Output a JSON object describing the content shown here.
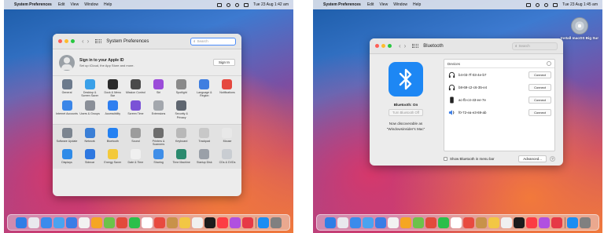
{
  "left": {
    "menubar": {
      "app": "System Preferences",
      "items": [
        "Edit",
        "View",
        "Window",
        "Help"
      ],
      "clock": "Tue 23 Aug  1:42 am"
    },
    "window": {
      "title": "System Preferences",
      "search_placeholder": "Search",
      "apple_id": {
        "title": "Sign in to your Apple ID",
        "subtitle": "Set up iCloud, the App Store and more.",
        "button": "Sign In"
      },
      "rows": [
        [
          {
            "label": "General",
            "color": "#6c7a8c",
            "icon": "general-icon"
          },
          {
            "label": "Desktop & Screen Saver",
            "color": "#3aa0e8",
            "icon": "desktop-icon"
          },
          {
            "label": "Dock & Menu Bar",
            "color": "#2b2b2b",
            "icon": "dock-icon"
          },
          {
            "label": "Mission Control",
            "color": "#4a4a4a",
            "icon": "mission-control-icon"
          },
          {
            "label": "Siri",
            "color": "#9b4cd9",
            "icon": "siri-icon"
          },
          {
            "label": "Spotlight",
            "color": "#8a8a8a",
            "icon": "spotlight-icon"
          },
          {
            "label": "Language & Region",
            "color": "#3f7ee0",
            "icon": "language-icon"
          },
          {
            "label": "Notifications",
            "color": "#e5483f",
            "icon": "notifications-icon"
          }
        ],
        [
          {
            "label": "Internet Accounts",
            "color": "#3a86e8",
            "icon": "at-icon"
          },
          {
            "label": "Users & Groups",
            "color": "#8a8f98",
            "icon": "users-icon"
          },
          {
            "label": "Accessibility",
            "color": "#2f7ff0",
            "icon": "accessibility-icon"
          },
          {
            "label": "Screen Time",
            "color": "#7b52d6",
            "icon": "hourglass-icon"
          },
          {
            "label": "Extensions",
            "color": "#a3a7ad",
            "icon": "puzzle-icon"
          },
          {
            "label": "Security & Privacy",
            "color": "#5f6670",
            "icon": "house-icon"
          }
        ],
        [
          {
            "label": "Software Update",
            "color": "#7c8590",
            "icon": "gear-icon"
          },
          {
            "label": "Network",
            "color": "#3b7fd6",
            "icon": "globe-icon"
          },
          {
            "label": "Bluetooth",
            "color": "#2481f2",
            "icon": "bluetooth-icon"
          },
          {
            "label": "Sound",
            "color": "#9c9c9c",
            "icon": "speaker-icon"
          },
          {
            "label": "Printers & Scanners",
            "color": "#6d6d6d",
            "icon": "printer-icon"
          },
          {
            "label": "Keyboard",
            "color": "#b8b8b8",
            "icon": "keyboard-icon"
          },
          {
            "label": "Trackpad",
            "color": "#c8c8c8",
            "icon": "trackpad-icon"
          },
          {
            "label": "Mouse",
            "color": "#e8e8e8",
            "icon": "mouse-icon"
          }
        ],
        [
          {
            "label": "Displays",
            "color": "#2f8be8",
            "icon": "display-icon"
          },
          {
            "label": "Sidecar",
            "color": "#2f78e0",
            "icon": "sidecar-icon"
          },
          {
            "label": "Energy Saver",
            "color": "#f3c93a",
            "icon": "bulb-icon"
          },
          {
            "label": "Date & Time",
            "color": "#f0f0f0",
            "icon": "clock-icon"
          },
          {
            "label": "Sharing",
            "color": "#3f8ee8",
            "icon": "sharing-icon"
          },
          {
            "label": "Time Machine",
            "color": "#2b8a6e",
            "icon": "time-machine-icon"
          },
          {
            "label": "Startup Disk",
            "color": "#9aa0a8",
            "icon": "disk-icon"
          },
          {
            "label": "CDs & DVDs",
            "color": "#c9cdd2",
            "icon": "cd-icon"
          }
        ]
      ]
    }
  },
  "right": {
    "menubar": {
      "app": "System Preferences",
      "items": [
        "Edit",
        "View",
        "Window",
        "Help"
      ],
      "clock": "Tue 23 Aug  1:45 am"
    },
    "desktop_icon_label": "Install macOS Big Sur",
    "window": {
      "title": "Bluetooth",
      "search_placeholder": "Search",
      "status": "Bluetooth: On",
      "toggle_button": "Turn Bluetooth Off",
      "discoverable_line1": "Now discoverable as",
      "discoverable_line2": "\"Windowsinsider's Mac\"",
      "devices_header": "Devices",
      "devices": [
        {
          "name": "b4-03-7f-03-4e-b7",
          "icon": "headphones-icon",
          "button": "Connect"
        },
        {
          "name": "b8-69-c2-c6-35-e4",
          "icon": "headphones-icon",
          "button": "Connect"
        },
        {
          "name": "ac-fb-c4-43-ee-7e",
          "icon": "phone-icon",
          "button": "Connect"
        },
        {
          "name": "f0-72-ea-e3-69-ab",
          "icon": "speaker-icon",
          "button": "Connect"
        }
      ],
      "show_in_menubar": "Show Bluetooth in menu bar",
      "advanced_button": "Advanced...",
      "help": "?"
    }
  },
  "dock_colors_left": [
    "#2f7ee6",
    "#e9e9ee",
    "#3a8bec",
    "#4aa3f0",
    "#3a7de6",
    "#f2f2f2",
    "#f5a623",
    "#6cc24a",
    "#e24a3b",
    "#2bbf4a",
    "#ffffff",
    "#e84a3f",
    "#c8924a",
    "#f2c744",
    "#f0f0f0",
    "#1c1c1c",
    "#fc3c44",
    "#b050e0",
    "#e63946",
    "#1b8df2",
    "#808080"
  ],
  "dock_colors_right": [
    "#2f7ee6",
    "#e9e9ee",
    "#3a8bec",
    "#4aa3f0",
    "#3a7de6",
    "#f2f2f2",
    "#f5a623",
    "#6cc24a",
    "#e24a3b",
    "#2bbf4a",
    "#ffffff",
    "#e84a3f",
    "#c8924a",
    "#f2c744",
    "#f0f0f0",
    "#1c1c1c",
    "#fc3c44",
    "#b050e0",
    "#e63946",
    "#1b8df2",
    "#808080"
  ]
}
